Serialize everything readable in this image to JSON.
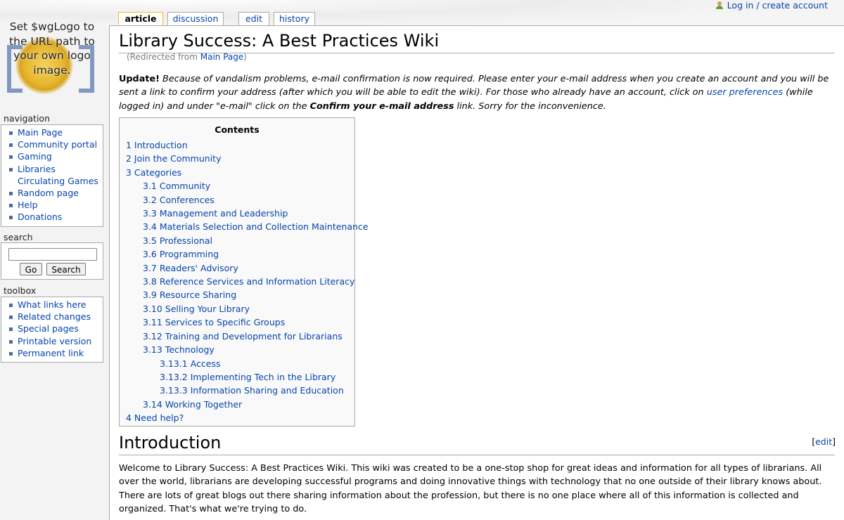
{
  "logo": {
    "text": "Set $wgLogo to the URL path to your own logo image."
  },
  "personal": {
    "login": "Log in / create account"
  },
  "tabs": [
    {
      "label": "article"
    },
    {
      "label": "discussion"
    },
    {
      "label": "edit"
    },
    {
      "label": "history"
    }
  ],
  "sidebar": {
    "navigation": {
      "heading": "navigation",
      "items": [
        "Main Page",
        "Community portal",
        "Gaming",
        "Libraries Circulating Games",
        "Random page",
        "Help",
        "Donations"
      ]
    },
    "search": {
      "heading": "search",
      "go": "Go",
      "search": "Search",
      "value": ""
    },
    "toolbox": {
      "heading": "toolbox",
      "items": [
        "What links here",
        "Related changes",
        "Special pages",
        "Printable version",
        "Permanent link"
      ]
    }
  },
  "page": {
    "title": "Library Success: A Best Practices Wiki",
    "redirect_prefix": "(Redirected from ",
    "redirect_link": "Main Page",
    "redirect_suffix": ")",
    "update_label": "Update!",
    "update_text1": " Because of vandalism problems, e-mail confirmation is now required. Please enter your e-mail address when you create an account and you will be sent a link to confirm your address (after which you will be able to edit the wiki). For those who already have an account, click on ",
    "update_link": "user preferences",
    "update_text2": " (while logged in) and under \"e-mail\" click on the ",
    "update_bold": "Confirm your e-mail address",
    "update_text3": " link. Sorry for the inconvenience."
  },
  "toc": {
    "title": "Contents",
    "items": [
      {
        "level": 1,
        "text": "1 Introduction"
      },
      {
        "level": 1,
        "text": "2 Join the Community"
      },
      {
        "level": 1,
        "text": "3 Categories"
      },
      {
        "level": 2,
        "text": "3.1 Community"
      },
      {
        "level": 2,
        "text": "3.2 Conferences"
      },
      {
        "level": 2,
        "text": "3.3 Management and Leadership"
      },
      {
        "level": 2,
        "text": "3.4 Materials Selection and Collection Maintenance"
      },
      {
        "level": 2,
        "text": "3.5 Professional"
      },
      {
        "level": 2,
        "text": "3.6 Programming"
      },
      {
        "level": 2,
        "text": "3.7 Readers' Advisory"
      },
      {
        "level": 2,
        "text": "3.8 Reference Services and Information Literacy"
      },
      {
        "level": 2,
        "text": "3.9 Resource Sharing"
      },
      {
        "level": 2,
        "text": "3.10 Selling Your Library"
      },
      {
        "level": 2,
        "text": "3.11 Services to Specific Groups"
      },
      {
        "level": 2,
        "text": "3.12 Training and Development for Librarians"
      },
      {
        "level": 2,
        "text": "3.13 Technology"
      },
      {
        "level": 3,
        "text": "3.13.1 Access"
      },
      {
        "level": 3,
        "text": "3.13.2 Implementing Tech in the Library"
      },
      {
        "level": 3,
        "text": "3.13.3 Information Sharing and Education"
      },
      {
        "level": 2,
        "text": "3.14 Working Together"
      },
      {
        "level": 1,
        "text": "4 Need help?"
      }
    ]
  },
  "intro": {
    "heading": "Introduction",
    "edit_open": "[",
    "edit_label": "edit",
    "edit_close": "]",
    "text": "Welcome to Library Success: A Best Practices Wiki. This wiki was created to be a one-stop shop for great ideas and information for all types of librarians. All over the world, librarians are developing successful programs and doing innovative things with technology that no one outside of their library knows about. There are lots of great blogs out there sharing information about the profession, but there is no one place where all of this information is collected and organized. That's what we're trying to do."
  }
}
